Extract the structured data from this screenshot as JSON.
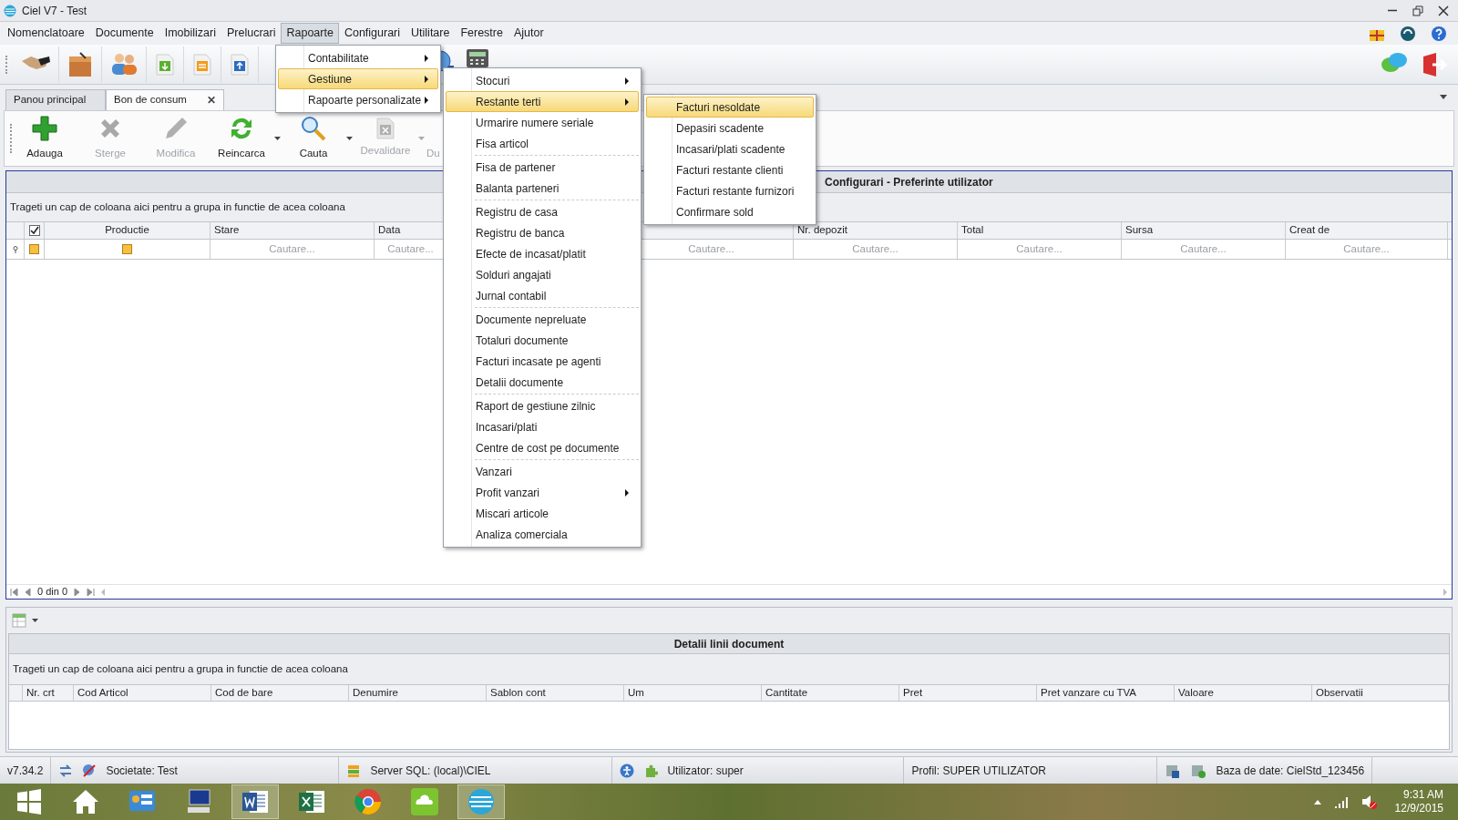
{
  "window": {
    "title": "Ciel V7 - Test"
  },
  "menu_bar": [
    {
      "label": "Nomenclatoare",
      "selected": false
    },
    {
      "label": "Documente",
      "selected": false
    },
    {
      "label": "Imobilizari",
      "selected": false
    },
    {
      "label": "Prelucrari",
      "selected": false
    },
    {
      "label": "Rapoarte",
      "selected": true
    },
    {
      "label": "Configurari",
      "selected": false
    },
    {
      "label": "Utilitare",
      "selected": false
    },
    {
      "label": "Ferestre",
      "selected": false
    },
    {
      "label": "Ajutor",
      "selected": false
    }
  ],
  "tabs": [
    {
      "label": "Panou principal",
      "selected": false,
      "closable": false
    },
    {
      "label": "Bon de consum",
      "selected": true,
      "closable": true
    }
  ],
  "close_glyph": "✕",
  "toolbar": [
    {
      "label": "Adauga",
      "disabled": false,
      "dropdown": false
    },
    {
      "label": "Sterge",
      "disabled": true,
      "dropdown": false
    },
    {
      "label": "Modifica",
      "disabled": true,
      "dropdown": false
    },
    {
      "label": "Reincarca",
      "disabled": false,
      "dropdown": true
    },
    {
      "label": "Cauta",
      "disabled": false,
      "dropdown": true
    },
    {
      "label": "Devalidare",
      "disabled": true,
      "dropdown": true
    },
    {
      "label": "Du",
      "disabled": true,
      "dropdown": false
    }
  ],
  "main_grid": {
    "title": "Configurari - Preferinte utilizator",
    "group_hint": "Trageti un cap de coloana aici pentru a grupa in functie de acea coloana",
    "header_checked": true,
    "filter_row_indeterminate": true,
    "columns": [
      {
        "label": "Productie",
        "kind": "checkbox",
        "indeterminate": true
      },
      {
        "label": "Stare",
        "kind": "search",
        "placeholder": "Cautare..."
      },
      {
        "label": "Data",
        "kind": "search",
        "placeholder": "Cautare..."
      },
      {
        "kind": "search",
        "placeholder": "Cautare..."
      },
      {
        "label": "Nr. depozit",
        "kind": "search",
        "placeholder": "Cautare..."
      },
      {
        "label": "Total",
        "kind": "search",
        "placeholder": "Cautare..."
      },
      {
        "label": "Sursa",
        "kind": "search",
        "placeholder": "Cautare..."
      },
      {
        "label": "Creat de",
        "kind": "search",
        "placeholder": "Cautare..."
      }
    ],
    "pager": "0 din 0"
  },
  "details_grid": {
    "title": "Detalii linii document",
    "group_hint": "Trageti un cap de coloana aici pentru a grupa in functie de acea coloana",
    "columns": [
      "Nr. crt",
      "Cod Articol",
      "Cod de bare",
      "Denumire",
      "Sablon cont",
      "Um",
      "Cantitate",
      "Pret",
      "Pret vanzare cu TVA",
      "Valoare",
      "Observatii"
    ]
  },
  "menus": [
    {
      "groups": [
        [
          {
            "label": "Contabilitate",
            "submenu": true,
            "selected": false
          },
          {
            "label": "Gestiune",
            "submenu": true,
            "selected": true
          },
          {
            "label": "Rapoarte personalizate",
            "submenu": true,
            "selected": false
          }
        ]
      ]
    },
    {
      "groups": [
        [
          {
            "label": "Stocuri",
            "submenu": true,
            "selected": false
          },
          {
            "label": "Restante terti",
            "submenu": true,
            "selected": true
          },
          {
            "label": "Urmarire numere seriale",
            "submenu": false,
            "selected": false
          },
          {
            "label": "Fisa articol",
            "submenu": false,
            "selected": false
          }
        ],
        [
          {
            "label": "Fisa de partener",
            "submenu": false,
            "selected": false
          },
          {
            "label": "Balanta parteneri",
            "submenu": false,
            "selected": false
          }
        ],
        [
          {
            "label": "Registru de casa",
            "submenu": false,
            "selected": false
          },
          {
            "label": "Registru de banca",
            "submenu": false,
            "selected": false
          },
          {
            "label": "Efecte de incasat/platit",
            "submenu": false,
            "selected": false
          },
          {
            "label": "Solduri angajati",
            "submenu": false,
            "selected": false
          },
          {
            "label": "Jurnal contabil",
            "submenu": false,
            "selected": false
          }
        ],
        [
          {
            "label": "Documente nepreluate",
            "submenu": false,
            "selected": false
          },
          {
            "label": "Totaluri documente",
            "submenu": false,
            "selected": false
          },
          {
            "label": "Facturi incasate pe agenti",
            "submenu": false,
            "selected": false
          },
          {
            "label": "Detalii documente",
            "submenu": false,
            "selected": false
          }
        ],
        [
          {
            "label": "Raport de gestiune zilnic",
            "submenu": false,
            "selected": false
          },
          {
            "label": "Incasari/plati",
            "submenu": false,
            "selected": false
          },
          {
            "label": "Centre de cost pe documente",
            "submenu": false,
            "selected": false
          }
        ],
        [
          {
            "label": "Vanzari",
            "submenu": false,
            "selected": false
          },
          {
            "label": "Profit vanzari",
            "submenu": true,
            "selected": false
          },
          {
            "label": "Miscari articole",
            "submenu": false,
            "selected": false
          },
          {
            "label": "Analiza comerciala",
            "submenu": false,
            "selected": false
          }
        ]
      ]
    },
    {
      "groups": [
        [
          {
            "label": "Facturi nesoldate",
            "submenu": false,
            "selected": true
          },
          {
            "label": "Depasiri scadente",
            "submenu": false,
            "selected": false
          },
          {
            "label": "Incasari/plati scadente",
            "submenu": false,
            "selected": false
          },
          {
            "label": "Facturi restante clienti",
            "submenu": false,
            "selected": false
          },
          {
            "label": "Facturi restante furnizori",
            "submenu": false,
            "selected": false
          },
          {
            "label": "Confirmare sold",
            "submenu": false,
            "selected": false
          }
        ]
      ]
    }
  ],
  "status_bar": {
    "version": "v7.34.2",
    "company": "Societate: Test",
    "server": "Server SQL: (local)\\CIEL",
    "user": "Utilizator: super",
    "profile": "Profil: SUPER UTILIZATOR",
    "database": "Baza de date: CielStd_123456"
  },
  "taskbar": {
    "time": "9:31 AM",
    "date": "12/9/2015"
  }
}
